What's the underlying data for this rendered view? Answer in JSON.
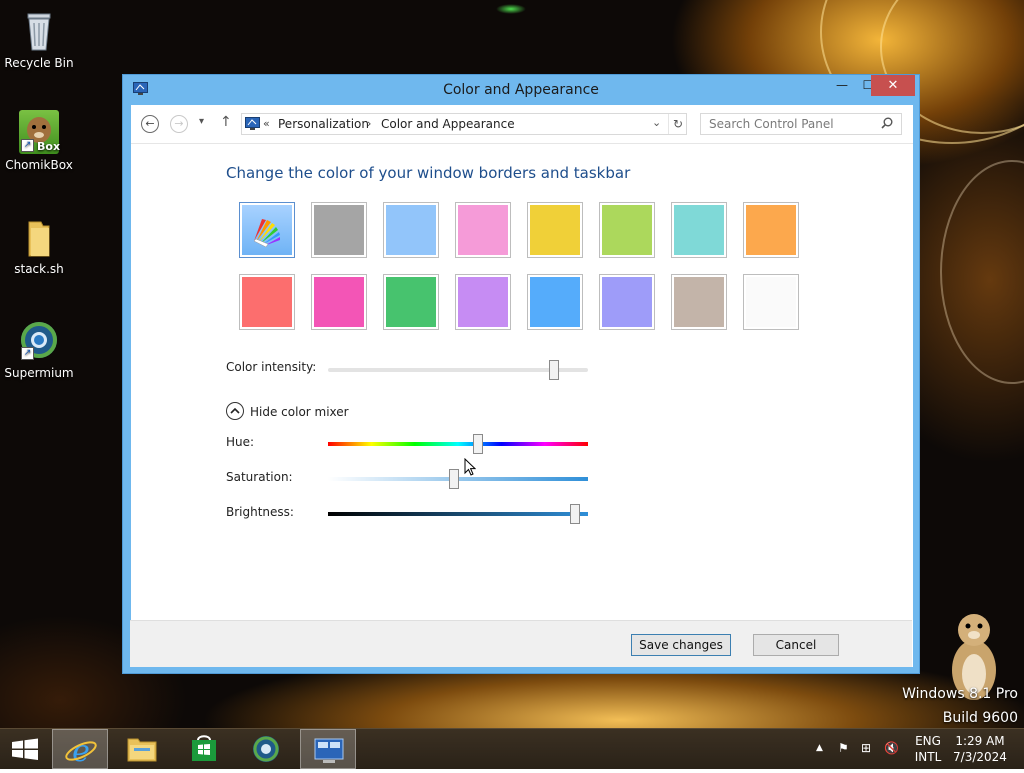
{
  "desktop": {
    "icons": [
      {
        "label": "Recycle Bin"
      },
      {
        "label": "ChomikBox",
        "badge_text": "Box"
      },
      {
        "label": "stack.sh"
      },
      {
        "label": "Supermium"
      }
    ],
    "watermark": {
      "line1": "Windows 8.1 Pro",
      "line2": "Build 9600"
    }
  },
  "window": {
    "title": "Color and Appearance",
    "controls": {
      "minimize": "—",
      "maximize": "☐",
      "close": "✕"
    },
    "nav": {
      "back_glyph": "←",
      "forward_glyph": "→",
      "recent_glyph": "▾",
      "up_glyph": "↑",
      "address": {
        "overflow": "«",
        "crumbs": [
          "Personalization",
          "Color and Appearance"
        ],
        "separator": "›",
        "dropdown_glyph": "⌄",
        "refresh_glyph": "↻"
      },
      "search_placeholder": "Search Control Panel"
    },
    "heading": "Change the color of your window borders and taskbar",
    "swatches": [
      {
        "color": "automatic",
        "selected": true
      },
      {
        "color": "#a5a5a5"
      },
      {
        "color": "#92c5fa"
      },
      {
        "color": "#f59bd8"
      },
      {
        "color": "#f0d038"
      },
      {
        "color": "#acd85c"
      },
      {
        "color": "#7fd9d7"
      },
      {
        "color": "#fca84d"
      },
      {
        "color": "#fc6e6e"
      },
      {
        "color": "#f355b6"
      },
      {
        "color": "#47c36e"
      },
      {
        "color": "#c68cf3"
      },
      {
        "color": "#55acfb"
      },
      {
        "color": "#9e9cf9"
      },
      {
        "color": "#c3b4a9"
      },
      {
        "color": "#fafafa"
      }
    ],
    "intensity": {
      "label": "Color intensity:",
      "value_fraction": 0.87
    },
    "mixer": {
      "toggle_label": "Hide color mixer",
      "hue": {
        "label": "Hue:",
        "value_fraction": 0.575
      },
      "saturation": {
        "label": "Saturation:",
        "value_fraction": 0.485
      },
      "brightness": {
        "label": "Brightness:",
        "value_fraction": 0.95
      }
    },
    "buttons": {
      "save": "Save changes",
      "cancel": "Cancel"
    }
  },
  "taskbar": {
    "language": {
      "line1": "ENG",
      "line2": "INTL"
    },
    "clock": {
      "time": "1:29 AM",
      "date": "7/3/2024"
    },
    "tray_glyphs": {
      "chevron": "▲",
      "flag": "⚑",
      "network": "⊞",
      "volume": "🔇"
    }
  }
}
